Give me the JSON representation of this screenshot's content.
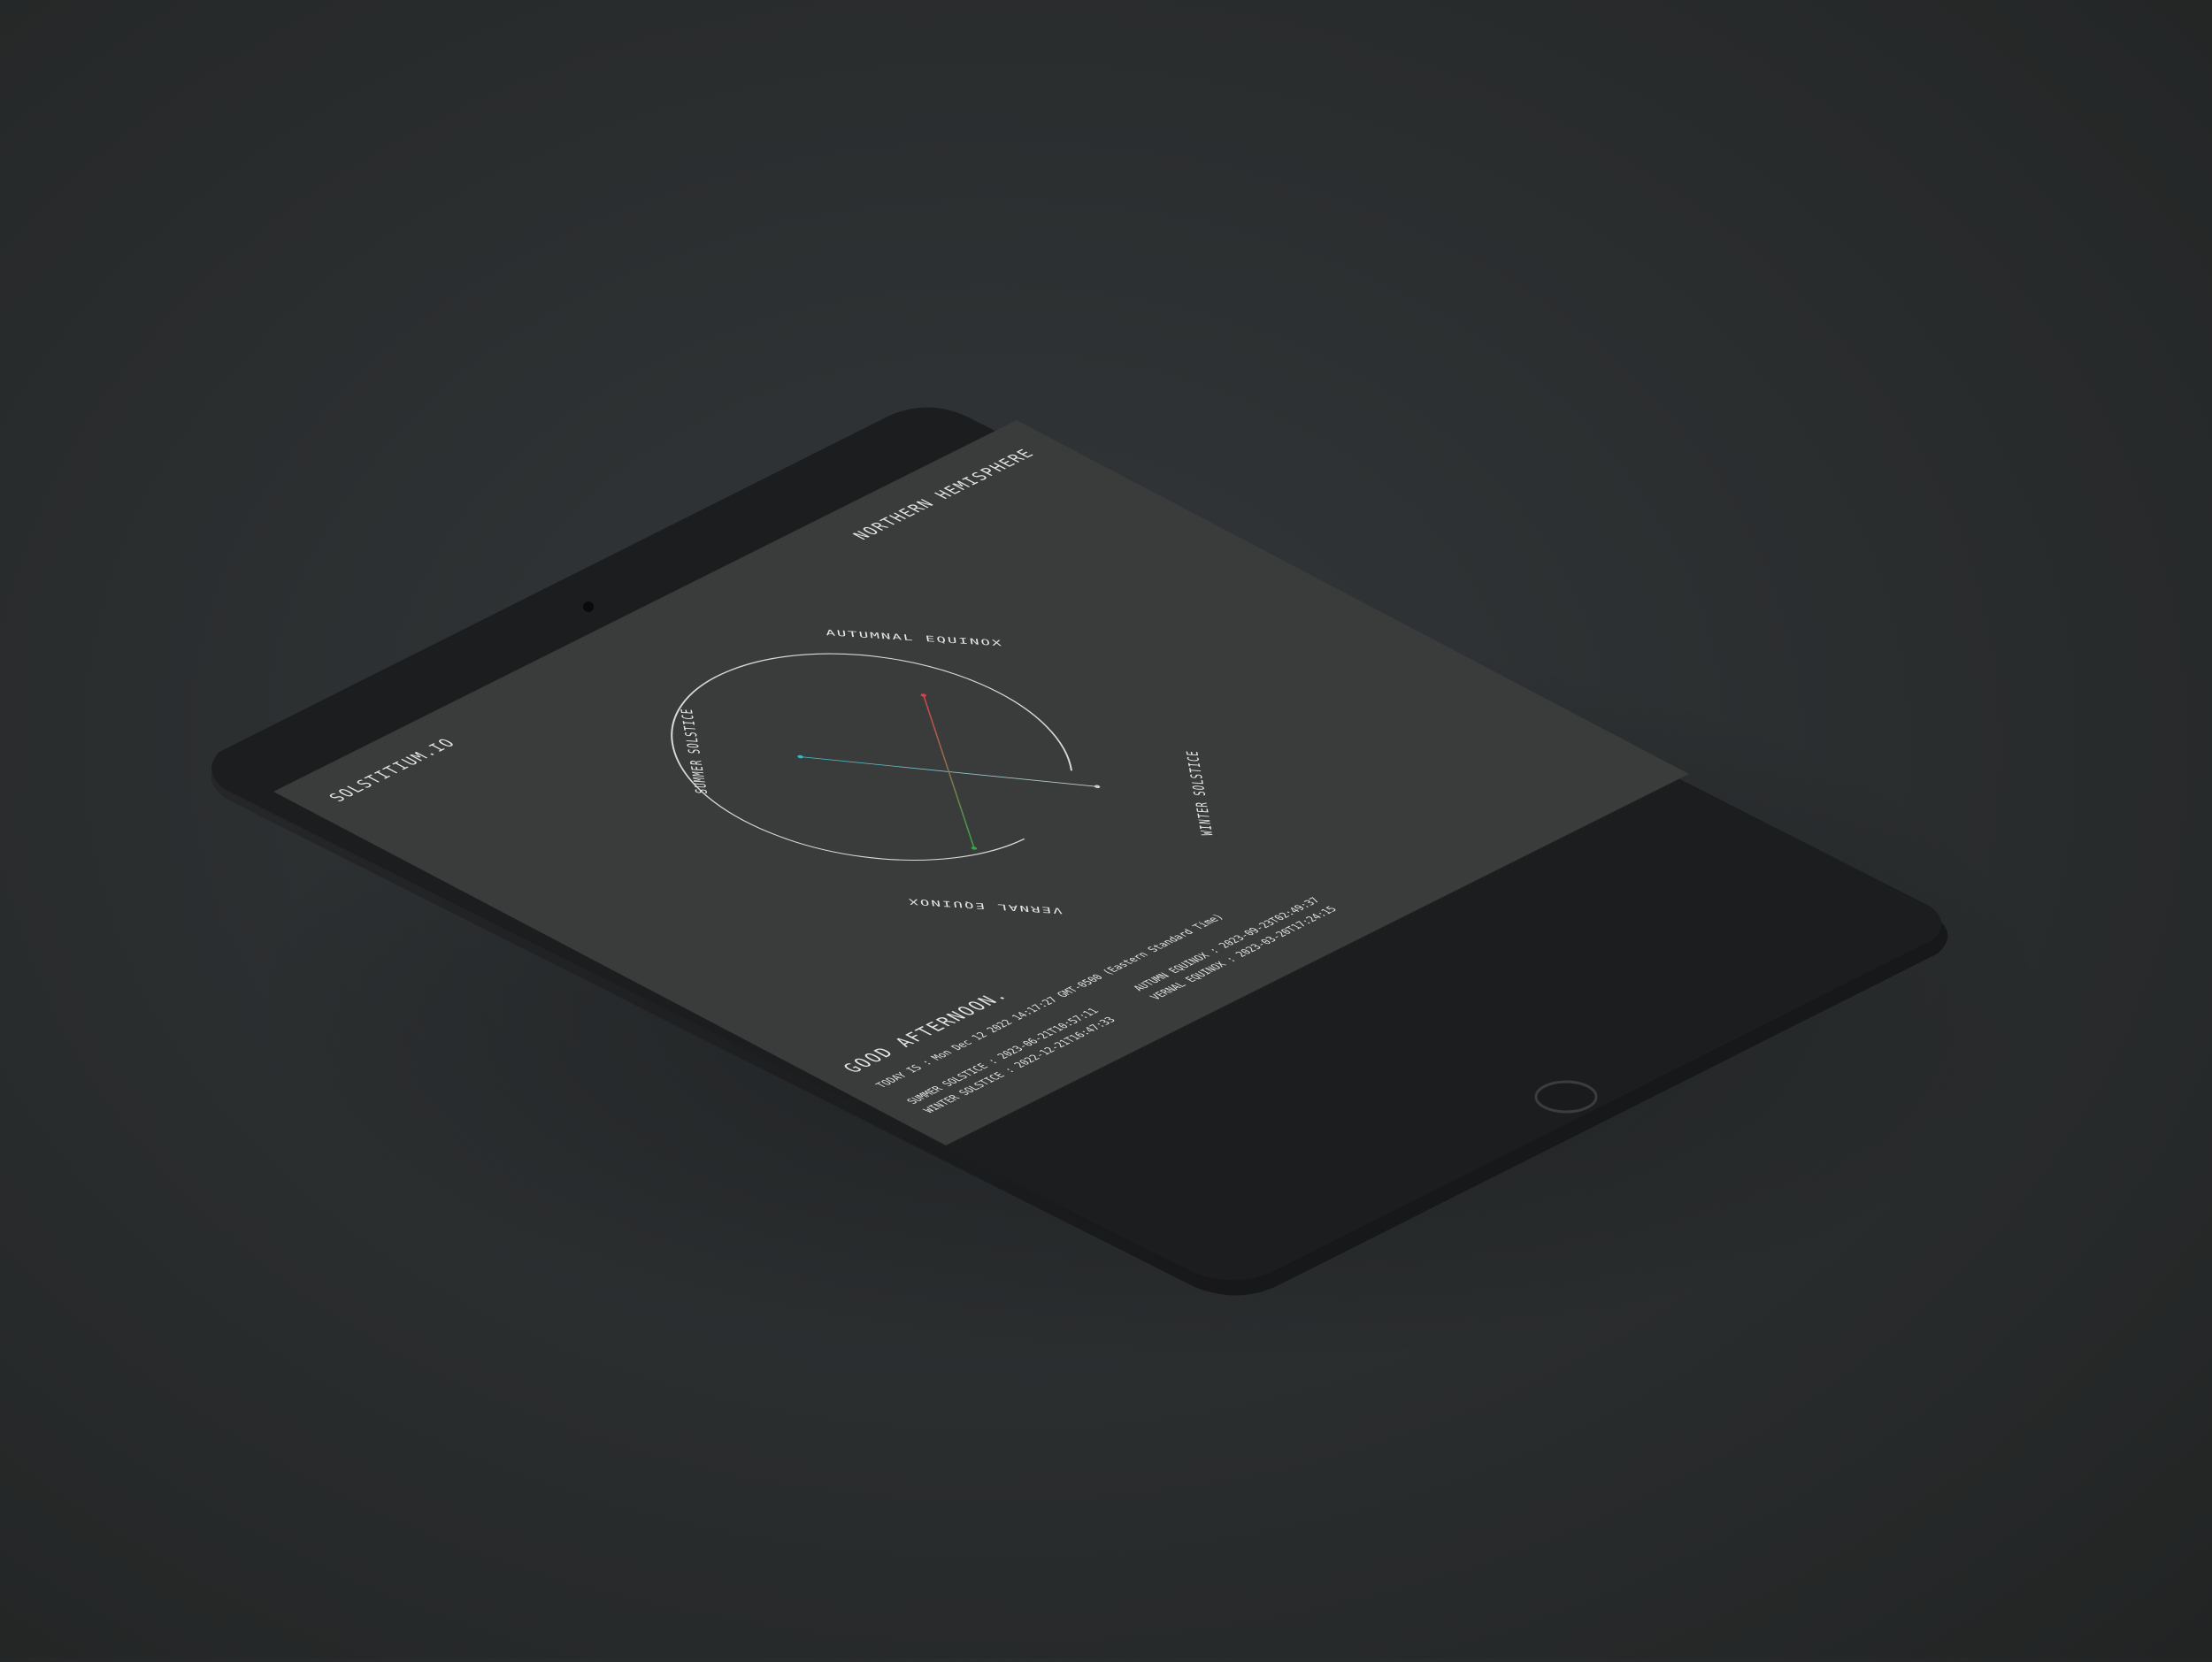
{
  "app": {
    "brand": "SOLSTITIUM.IO",
    "hemisphere": "NORTHERN HEMISPHERE"
  },
  "diagram": {
    "summer_solstice": "SUMMER SOLSTICE",
    "autumnal_equinox": "AUTUMNAL EQUINOX",
    "vernal_equinox": "VERNAL EQUINOX",
    "winter_solstice": "WINTER SOLSTICE"
  },
  "info": {
    "greeting": "GOOD AFTERNOON.",
    "today": "TODAY IS : Mon Dec 12 2022 14:17:27 GMT-0500 (Eastern Standard Time)",
    "summer_line": "SUMMER SOLSTICE : 2023-06-21T10:57:11",
    "autumn_line": "AUTUMN EQUINOX  : 2023-09-23T02:49:37",
    "winter_line": "WINTER SOLSTICE : 2022-12-21T16:47:33",
    "vernal_line": "VERNAL EQUINOX  : 2023-03-20T17:24:15"
  },
  "colors": {
    "screen": "#3a3b3b",
    "device": "#1b1c1d",
    "text": "#e6e6e6",
    "summer": "#3fb6c4",
    "autumn": "#d7434b",
    "vernal": "#3aa24d",
    "winter": "#cfcfcf"
  }
}
